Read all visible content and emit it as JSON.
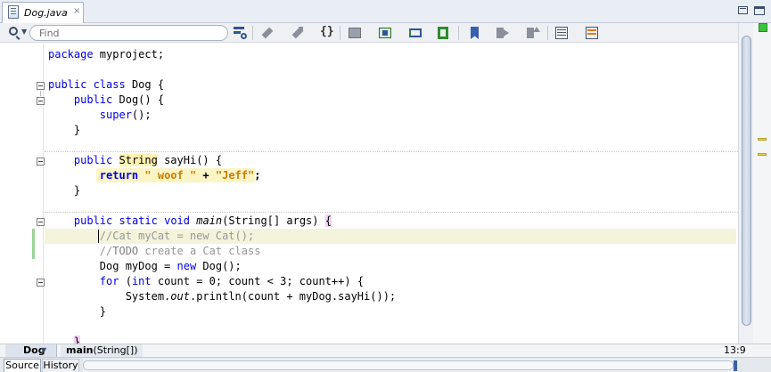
{
  "editor_tab": {
    "title": "Dog.java",
    "close_label": "×"
  },
  "toolbar": {
    "find_placeholder": "Find",
    "buttons": [
      "search-history-icon",
      "toggle-highlight-icon",
      "toggle-rectangular-selection-icon",
      "brace-match-icon",
      "shift-line-left-icon",
      "shift-line-right-icon",
      "comment-icon",
      "uncomment-icon",
      "run-macro-icon",
      "toggle-bookmark-icon",
      "previous-bookmark-icon",
      "next-bookmark-icon",
      "start-macro-icon",
      "stop-macro-icon"
    ]
  },
  "code_lines": [
    "package myproject;",
    "",
    "public class Dog {",
    "    public Dog() {",
    "        super();",
    "    }",
    "",
    "    public String sayHi() {",
    "        return \" woof \" + \"Jeff\";",
    "    }",
    "",
    "    public static void main(String[] args) {",
    "        //Cat myCat = new Cat();",
    "        //TODO create a Cat class",
    "        Dog myDog = new Dog();",
    "        for (int count = 0; count < 3; count++) {",
    "            System.out.println(count + myDog.sayHi());",
    "        }",
    "",
    "    }"
  ],
  "code": {
    "l1": {
      "kw": "package",
      "rest": " myproject;"
    },
    "l3": {
      "kw1": "public",
      "kw2": "class",
      "rest": " Dog {"
    },
    "l4": {
      "kw": "public",
      "rest": " Dog() {"
    },
    "l5": {
      "kw": "super",
      "rest": "();"
    },
    "l6": {
      "rest": "}"
    },
    "l8": {
      "kw": "public",
      "type": "String",
      "rest": " sayHi() {"
    },
    "l9": {
      "kw": "return",
      "s1": "\" woof \"",
      "op": " + ",
      "s2": "\"Jeff\"",
      "end": ";"
    },
    "l10": {
      "rest": "}"
    },
    "l12": {
      "kw1": "public",
      "kw2": "static",
      "kw3": "void",
      "name": "main",
      "rest": "(String[] args) ",
      "brace": "{"
    },
    "l13": {
      "comment": "//Cat myCat = new Cat();"
    },
    "l14": {
      "prefix": "//",
      "todo": "TODO",
      "rest": " create a Cat class"
    },
    "l15": {
      "pre": "Dog myDog = ",
      "kw": "new",
      "rest": " Dog();"
    },
    "l16": {
      "kw1": "for",
      "p1": " (",
      "kw2": "int",
      "rest": " count = 0; count < 3; count++) {"
    },
    "l17": {
      "pre": "System.",
      "field": "out",
      "rest": ".println(count + myDog.sayHi());"
    },
    "l18": {
      "rest": "}"
    },
    "l20": {
      "rest": "}"
    }
  },
  "navigator": {
    "class_name": "Dog",
    "method": "main",
    "method_params": "(String[])",
    "cursor_position": "13:9"
  },
  "bottom_tabs": {
    "source": "Source",
    "history": "History"
  },
  "colors": {
    "keyword": "#0000e6",
    "string": "#ce7b00",
    "comment": "#969696",
    "caret_line": "#f4f4dc",
    "occurrence_highlight": "#fff3b3",
    "status_ok": "#3ec13e"
  }
}
